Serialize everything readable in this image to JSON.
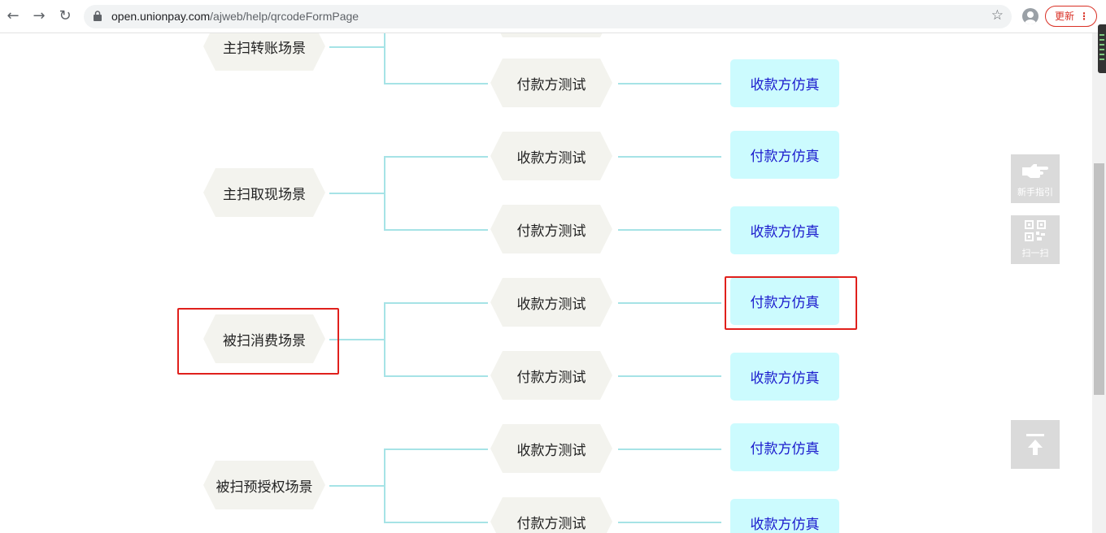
{
  "browser": {
    "url_host": "open.unionpay.com",
    "url_path": "/ajweb/help/qrcodeFormPage",
    "update_label": "更新"
  },
  "rows": [
    {
      "scene": "主扫转账场景",
      "tests": [
        {
          "label": "付款方测试",
          "sim": "收款方仿真"
        }
      ]
    },
    {
      "scene": "主扫取现场景",
      "tests": [
        {
          "label": "收款方测试",
          "sim": "付款方仿真"
        },
        {
          "label": "付款方测试",
          "sim": "收款方仿真"
        }
      ]
    },
    {
      "scene": "被扫消费场景",
      "tests": [
        {
          "label": "收款方测试",
          "sim": "付款方仿真"
        },
        {
          "label": "付款方测试",
          "sim": "收款方仿真"
        }
      ]
    },
    {
      "scene": "被扫预授权场景",
      "tests": [
        {
          "label": "收款方测试",
          "sim": "付款方仿真"
        },
        {
          "label": "付款方测试",
          "sim": "收款方仿真"
        }
      ]
    }
  ],
  "partial_top": {
    "sim_visible": true
  },
  "side_widgets": {
    "guide_label": "新手指引",
    "scan_label": "扫一扫"
  },
  "colors": {
    "connector": "#a6e3e6",
    "sim_bg": "#ccfbfe",
    "sim_text": "#1a1acd",
    "hex_bg": "#f3f3ee",
    "highlight": "#e0201c"
  }
}
